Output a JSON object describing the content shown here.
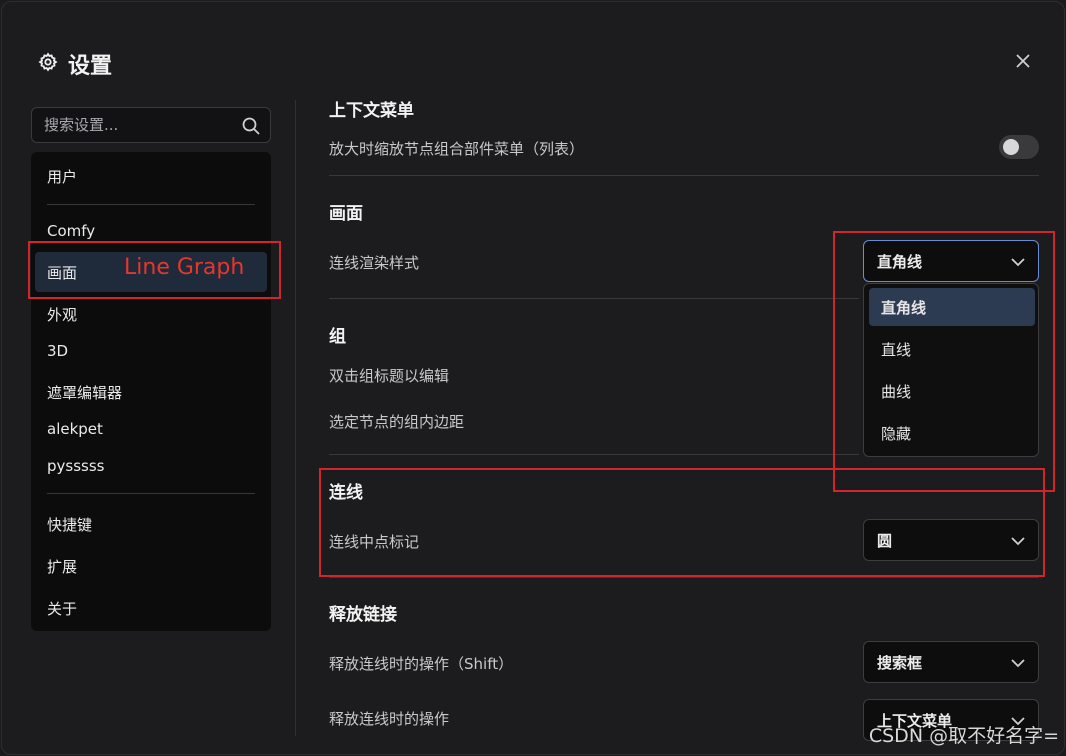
{
  "dialog": {
    "title": "设置",
    "close_icon": "close-icon",
    "settings_icon": "gear-icon"
  },
  "search": {
    "placeholder": "搜索设置...",
    "icon": "search-icon"
  },
  "sidebar": {
    "items": [
      {
        "label": "用户"
      },
      {
        "label": "Comfy"
      },
      {
        "label": "画面"
      },
      {
        "label": "外观"
      },
      {
        "label": "3D"
      },
      {
        "label": "遮罩编辑器"
      },
      {
        "label": "alekpet"
      },
      {
        "label": "pysssss"
      },
      {
        "label": "快捷键"
      },
      {
        "label": "扩展"
      },
      {
        "label": "关于"
      }
    ],
    "active": "画面"
  },
  "annotation": {
    "line_graph": "Line Graph",
    "color": "#d2252b"
  },
  "content": {
    "context_menu": {
      "heading": "上下文菜单",
      "zoom_label": "放大时缩放节点组合部件菜单（列表）",
      "zoom_enabled": false
    },
    "canvas": {
      "heading": "画面",
      "link_render_label": "连线渲染样式",
      "link_render_value": "直角线",
      "options": [
        "直角线",
        "直线",
        "曲线",
        "隐藏"
      ],
      "selected_option": "直角线"
    },
    "group": {
      "heading": "组",
      "double_click_label": "双击组标题以编辑",
      "padding_label": "选定节点的组内边距"
    },
    "link": {
      "heading": "连线",
      "midpoint_label": "连线中点标记",
      "midpoint_value": "圆"
    },
    "release": {
      "heading": "释放链接",
      "shift_label": "释放连线时的操作（Shift）",
      "shift_value": "搜索框",
      "action_label": "释放连线时的操作",
      "action_value": "上下文菜单"
    }
  },
  "watermark": "CSDN @取不好名字="
}
